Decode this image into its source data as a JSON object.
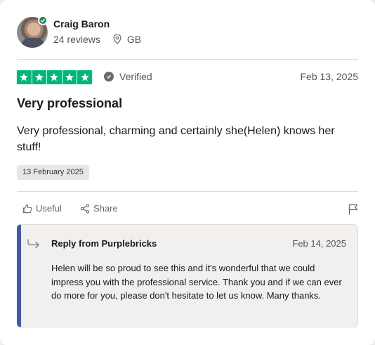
{
  "reviewer": {
    "name": "Craig Baron",
    "reviews": "24 reviews",
    "country": "GB"
  },
  "review": {
    "rating": 5,
    "verified_label": "Verified",
    "date": "Feb 13, 2025",
    "title": "Very professional",
    "body": "Very professional, charming and certainly she(Helen) knows her stuff!",
    "experience_date": "13 February 2025"
  },
  "actions": {
    "useful_label": "Useful",
    "share_label": "Share"
  },
  "reply": {
    "title": "Reply from Purplebricks",
    "date": "Feb 14, 2025",
    "body": "Helen will be so proud to see this and it's wonderful that we could impress you with the professional service. Thank you and if we can ever do more for you, please don't hesitate to let us know. Many thanks."
  },
  "colors": {
    "star_green": "#00b67a",
    "reply_accent": "#3c57bc",
    "verified_badge": "#1c8a5b"
  },
  "icons": [
    "avatar",
    "verified-check-icon",
    "location-pin-icon",
    "star-icon",
    "check-circle-icon",
    "thumbs-up-icon",
    "share-icon",
    "flag-icon",
    "reply-arrow-icon"
  ]
}
